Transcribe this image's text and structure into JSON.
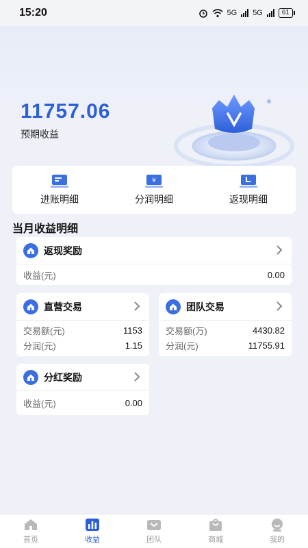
{
  "status": {
    "time": "15:20",
    "battery": "61",
    "net1": "5G",
    "net2": "5G"
  },
  "hero": {
    "amount": "11757.06",
    "label": "预期收益"
  },
  "quick": [
    {
      "label": "进账明细"
    },
    {
      "label": "分润明细"
    },
    {
      "label": "返现明细"
    }
  ],
  "section_title": "当月收益明细",
  "cards": {
    "cashback": {
      "title": "返现奖励",
      "rows": [
        {
          "k": "收益(元)",
          "v": "0.00"
        }
      ]
    },
    "direct": {
      "title": "直营交易",
      "rows": [
        {
          "k": "交易额(元)",
          "v": "1153"
        },
        {
          "k": "分润(元)",
          "v": "1.15"
        }
      ]
    },
    "team": {
      "title": "团队交易",
      "rows": [
        {
          "k": "交易额(万)",
          "v": "4430.82"
        },
        {
          "k": "分润(元)",
          "v": "11755.91"
        }
      ]
    },
    "dividend": {
      "title": "分红奖励",
      "rows": [
        {
          "k": "收益(元)",
          "v": "0.00"
        }
      ]
    }
  },
  "tabs": [
    {
      "label": "首页",
      "icon": "home-icon"
    },
    {
      "label": "收益",
      "icon": "chart-icon"
    },
    {
      "label": "团队",
      "icon": "team-icon"
    },
    {
      "label": "商城",
      "icon": "bag-icon"
    },
    {
      "label": "我的",
      "icon": "profile-icon"
    }
  ],
  "colors": {
    "accent": "#2e5fd8",
    "icon_blue": "#3b6ee0",
    "background": "#eef1f7"
  }
}
